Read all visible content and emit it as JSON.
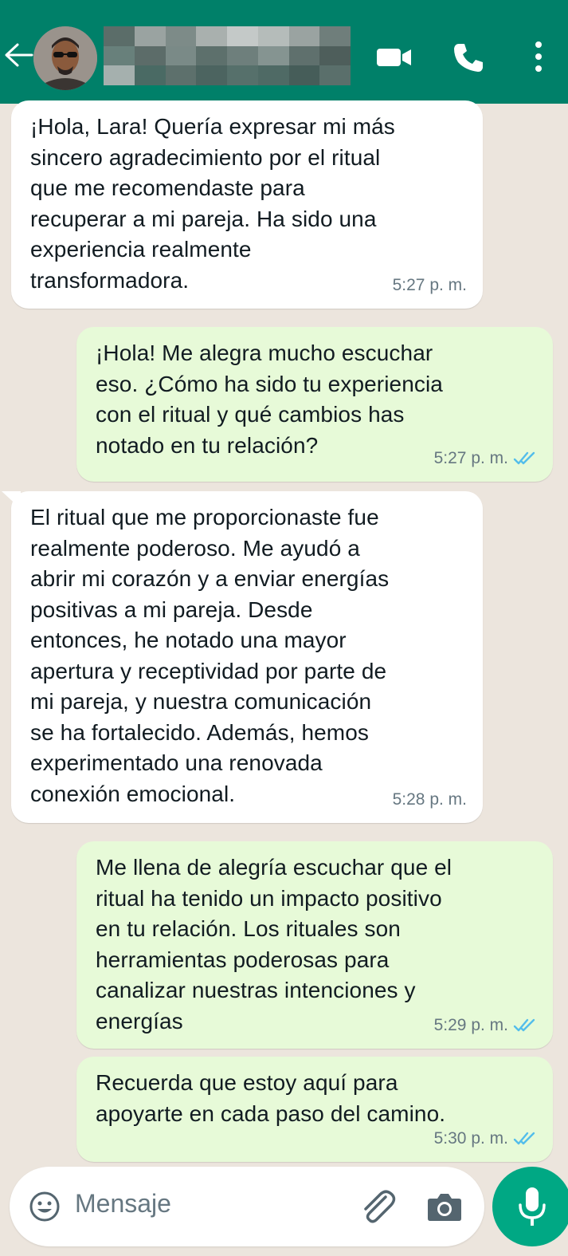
{
  "header": {
    "contact_name": "",
    "icons": [
      "back-arrow-icon",
      "avatar",
      "video-call-icon",
      "phone-call-icon",
      "more-options-icon"
    ],
    "colors": {
      "header_bg": "#008069",
      "chat_bg": "#ece5dd",
      "incoming_bubble": "#ffffff",
      "outgoing_bubble": "#e7fad8",
      "read_ticks": "#53bdeb",
      "mic_button": "#00a884"
    }
  },
  "messages": [
    {
      "direction": "incoming",
      "text": "¡Hola, Lara! Quería expresar mi más\nsincero agradecimiento por el ritual\nque me recomendaste para\nrecuperar a mi pareja. Ha sido una\nexperiencia realmente\ntransformadora.",
      "time": "5:27 p. m."
    },
    {
      "direction": "outgoing",
      "text": "¡Hola! Me alegra mucho escuchar\neso. ¿Cómo ha sido tu experiencia\ncon el ritual y qué cambios has\nnotado en tu relación?",
      "time": "5:27 p. m.",
      "status": "read"
    },
    {
      "direction": "incoming",
      "text": "El ritual que me proporcionaste fue\nrealmente poderoso. Me ayudó a\nabrir mi corazón y a enviar energías\npositivas a mi pareja. Desde\nentonces, he notado una mayor\napertura y receptividad por parte de\nmi pareja, y nuestra comunicación\nse ha fortalecido. Además, hemos\nexperimentado una renovada\nconexión emocional.",
      "time": "5:28 p. m."
    },
    {
      "direction": "outgoing",
      "text": "Me llena de alegría escuchar que el\nritual ha tenido un impacto positivo\nen tu relación. Los rituales son\nherramientas poderosas para\ncanalizar nuestras intenciones y\nenergías",
      "time": "5:29 p. m.",
      "status": "read"
    },
    {
      "direction": "outgoing",
      "text": "Recuerda que estoy aquí para\napoyarte en cada paso del camino.",
      "time": "5:30 p. m.",
      "status": "read"
    }
  ],
  "input": {
    "placeholder": "Mensaje",
    "icons": [
      "emoji-icon",
      "attach-icon",
      "camera-icon",
      "mic-icon"
    ]
  }
}
